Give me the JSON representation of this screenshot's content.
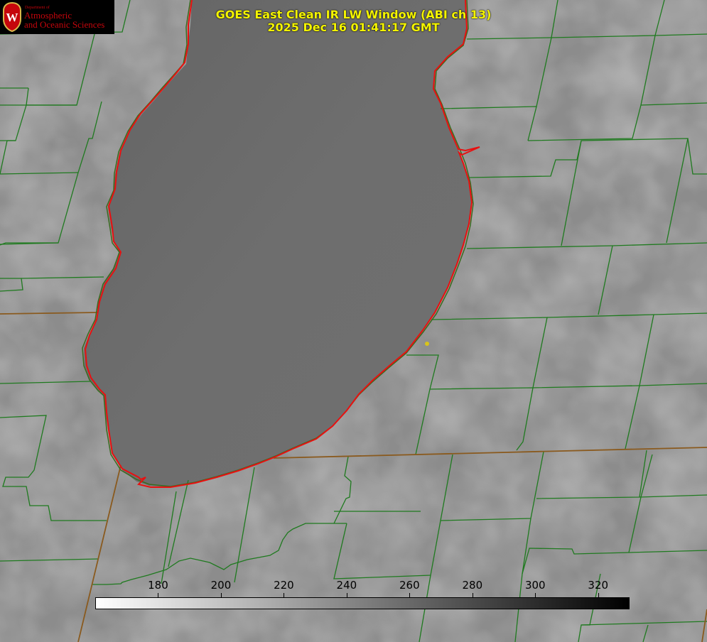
{
  "logo": {
    "department": "Department of",
    "line1": "Atmospheric",
    "line2": "and Oceanic Sciences",
    "seal_letter": "W",
    "color": "#c5050c"
  },
  "title": {
    "line1": "GOES East Clean IR LW Window (ABI ch 13)",
    "line2": "2025 Dec 16 01:41:17 GMT",
    "color": "#f4f400"
  },
  "colorbar": {
    "min": 160,
    "max": 330,
    "ticks": [
      "180",
      "200",
      "220",
      "240",
      "260",
      "280",
      "300",
      "320"
    ],
    "color_low": "#ffffff",
    "color_high": "#000000"
  },
  "map": {
    "lake_outline_color": "#e81010",
    "boundary_color": "#1f7a1f",
    "state_line_color": "#8a5a1e",
    "marker_color": "#d8c41a",
    "land_gray": "#8c8c8c",
    "lake_gray": "#6c6c6c",
    "cloud_gray": "#9e9e9e"
  }
}
